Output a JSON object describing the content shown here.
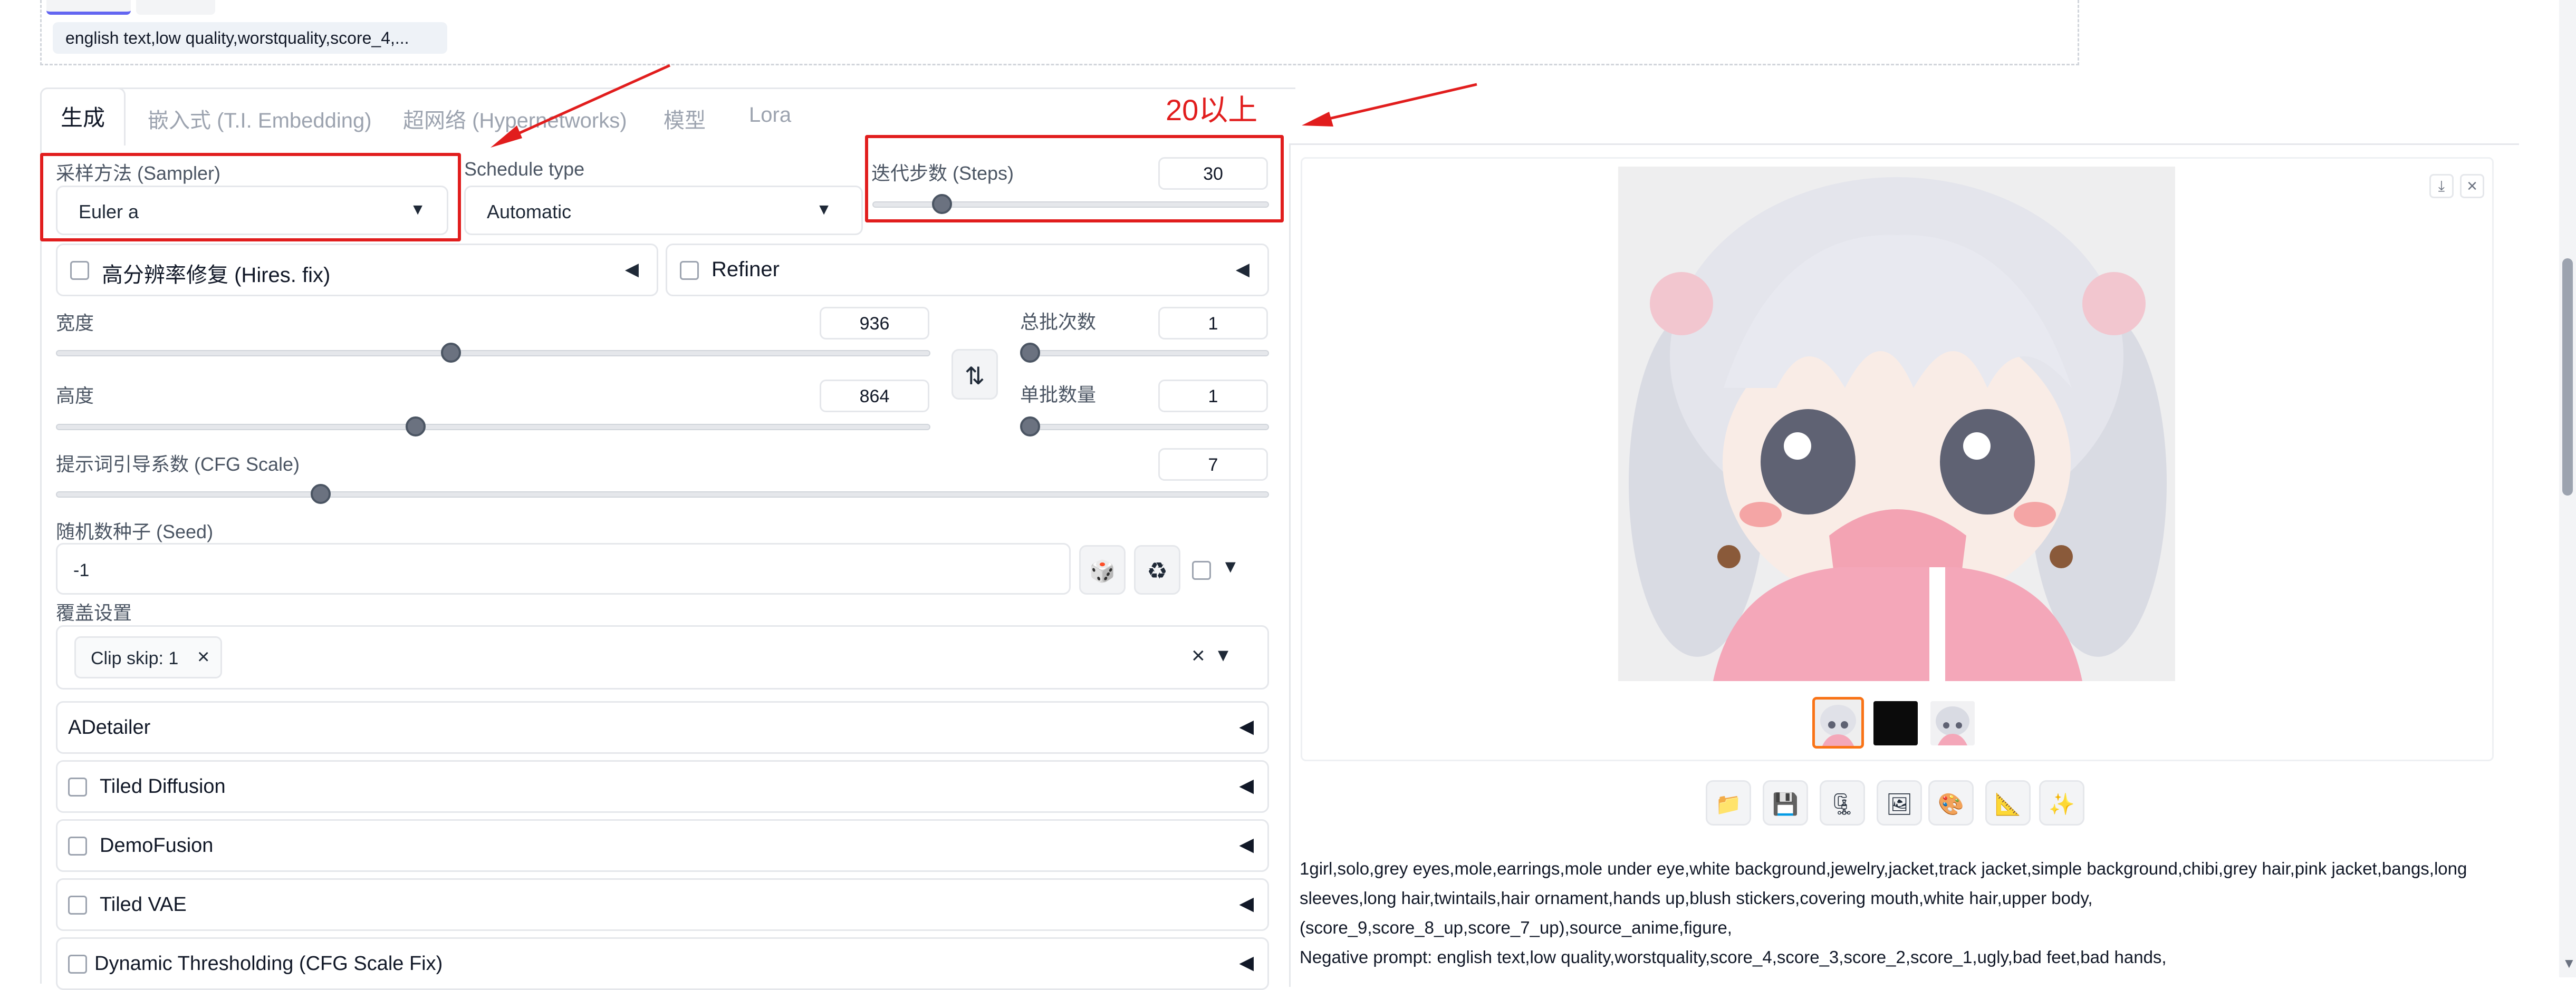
{
  "prompt_area": {
    "negative_summary": "english text,low quality,worstquality,score_4,..."
  },
  "tabs": [
    {
      "label": "生成",
      "active": true
    },
    {
      "label": "嵌入式 (T.I. Embedding)",
      "active": false
    },
    {
      "label": "超网络 (Hypernetworks)",
      "active": false
    },
    {
      "label": "模型",
      "active": false
    },
    {
      "label": "Lora",
      "active": false
    }
  ],
  "annotation": {
    "note": "20以上"
  },
  "sampler": {
    "label": "采样方法 (Sampler)",
    "value": "Euler a"
  },
  "schedule": {
    "label": "Schedule type",
    "value": "Automatic"
  },
  "steps": {
    "label": "迭代步数 (Steps)",
    "value": "30",
    "fraction": 0.15
  },
  "hires": {
    "label": "高分辨率修复 (Hires. fix)"
  },
  "refiner": {
    "label": "Refiner"
  },
  "width": {
    "label": "宽度",
    "value": "936",
    "fraction": 0.44
  },
  "height": {
    "label": "高度",
    "value": "864",
    "fraction": 0.4
  },
  "batch_count": {
    "label": "总批次数",
    "value": "1",
    "fraction": 0.0
  },
  "batch_size": {
    "label": "单批数量",
    "value": "1",
    "fraction": 0.0
  },
  "cfg": {
    "label": "提示词引导系数 (CFG Scale)",
    "value": "7",
    "fraction": 0.21
  },
  "seed": {
    "label": "随机数种子 (Seed)",
    "value": "-1"
  },
  "override": {
    "label": "覆盖设置",
    "chip": "Clip skip: 1"
  },
  "accordions": [
    {
      "label": "ADetailer",
      "checkbox": false
    },
    {
      "label": "Tiled Diffusion",
      "checkbox": true
    },
    {
      "label": "DemoFusion",
      "checkbox": true
    },
    {
      "label": "Tiled VAE",
      "checkbox": true
    },
    {
      "label": "Dynamic Thresholding (CFG Scale Fix)",
      "checkbox": true
    }
  ],
  "output": {
    "info_lines": [
      "1girl,solo,grey eyes,mole,earrings,mole under eye,white background,jewelry,jacket,track jacket,simple background,chibi,grey hair,pink jacket,bangs,long",
      "sleeves,long hair,twintails,hair ornament,hands up,blush stickers,covering mouth,white hair,upper body,",
      "(score_9,score_8_up,score_7_up),source_anime,figure,",
      "Negative prompt: english text,low quality,worstquality,score_4,score_3,score_2,score_1,ugly,bad feet,bad hands,"
    ]
  },
  "icons": {
    "swap": "⇅",
    "dice": "🎲",
    "recycle": "♻",
    "dropdown": "▼",
    "close": "×",
    "folder": "📁",
    "save": "💾",
    "zip": "🗜",
    "image": "🖼",
    "palette": "🎨",
    "ruler": "📐",
    "sparkle": "✨",
    "download": "⤓",
    "collapse": "◀",
    "caret": "▾"
  },
  "colors": {
    "accent": "#f97316",
    "annotation": "#e11d1d"
  }
}
